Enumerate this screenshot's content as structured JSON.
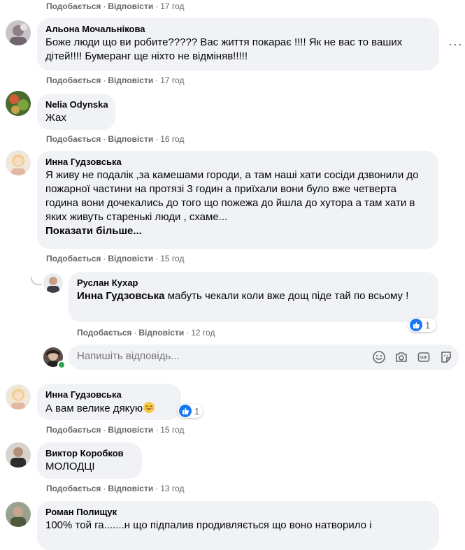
{
  "labels": {
    "like": "Подобається",
    "reply": "Відповісти",
    "more_dots": "···"
  },
  "comments": [
    {
      "time": "17 год"
    },
    {
      "author": "Альона Мочальнікова",
      "text": "Боже люди що ви робите????? Вас життя покарає !!!! Як не вас то ваших дітей!!!! Бумеранг ще ніхто не відміняв!!!!!",
      "time": "17 год"
    },
    {
      "author": "Nelia Odynska",
      "text": "Жах",
      "time": "16 год"
    },
    {
      "author": "Инна Гудзовська",
      "text": "Я живу не подалік ,за камешами городи, а там наші хати сосіди дзвонили до пожарної частини на протязі 3 годин а приїхали вони було вже четверта година вони дочекались до того що пожежа до йшла до хутора а там хати в яких живуть старенькі люди , схаме...",
      "more": "Показати більше...",
      "time": "15 год"
    },
    {
      "author": "Руслан Кухар",
      "mention": "Инна Гудзовська",
      "text": " мабуть чекали коли вже дощ піде тай по всьому !",
      "time": "12 год",
      "reactions": "1"
    },
    {
      "author": "Инна Гудзовська",
      "text": "А вам велике дякую",
      "time": "15 год",
      "reactions": "1"
    },
    {
      "author": "Виктор Коробков",
      "text": "МОЛОДЦІ",
      "time": "13 год"
    },
    {
      "author": "Роман Полищук",
      "text": "100% той га.......н що підпалив продивляється що воно натворило і"
    }
  ],
  "reply_box": {
    "placeholder": "Напишіть відповідь..."
  },
  "colors": {
    "bubble": "#f0f2f5",
    "meta": "#65676b",
    "like_blue": "#1877f2",
    "online_green": "#31a24c"
  }
}
